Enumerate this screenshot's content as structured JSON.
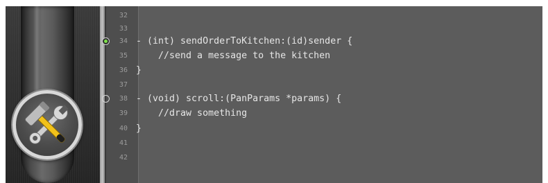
{
  "editor": {
    "lines": [
      {
        "num": "32",
        "code": "",
        "breakpoint": "none"
      },
      {
        "num": "33",
        "code": "",
        "breakpoint": "none"
      },
      {
        "num": "34",
        "code": "- (int) sendOrderToKitchen:(id)sender {",
        "breakpoint": "active"
      },
      {
        "num": "35",
        "code": "    //send a message to the kitchen",
        "breakpoint": "none"
      },
      {
        "num": "36",
        "code": "}",
        "breakpoint": "none"
      },
      {
        "num": "37",
        "code": "",
        "breakpoint": "none"
      },
      {
        "num": "38",
        "code": "- (void) scroll:(PanParams *params) {",
        "breakpoint": "inactive"
      },
      {
        "num": "39",
        "code": "    //draw something",
        "breakpoint": "none"
      },
      {
        "num": "40",
        "code": "}",
        "breakpoint": "none"
      },
      {
        "num": "41",
        "code": "",
        "breakpoint": "none"
      },
      {
        "num": "42",
        "code": "",
        "breakpoint": "none"
      }
    ]
  },
  "icons": {
    "tools": "hammer-and-wrench-icon",
    "breakpoint_active": "green-breakpoint-icon",
    "breakpoint_inactive": "empty-breakpoint-icon"
  },
  "colors": {
    "background": "#5c5c5c",
    "gutter": "#4e4e4e",
    "code_text": "#e6e6e6",
    "line_number": "#9c9c9c",
    "breakpoint_active": "#7ee04a"
  }
}
